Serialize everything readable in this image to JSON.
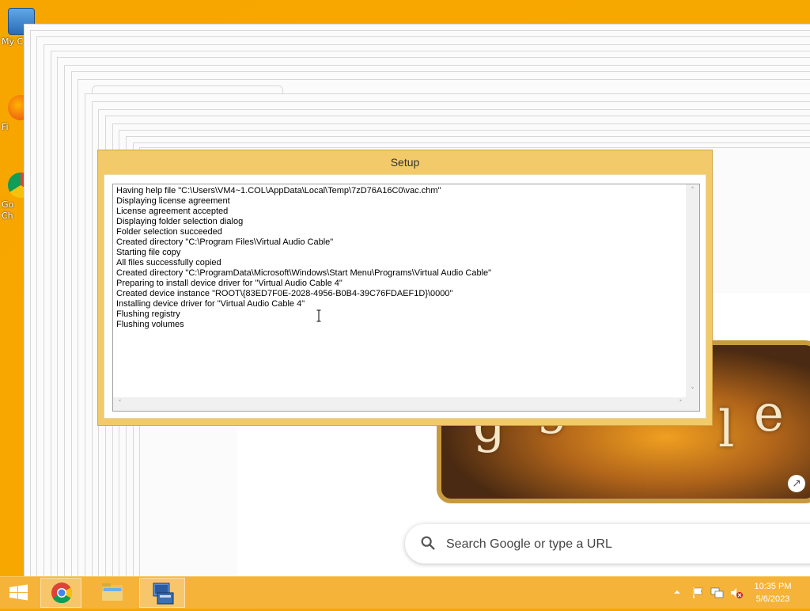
{
  "desktop": {
    "icons": [
      {
        "name": "my-computer-icon",
        "label": "My C"
      },
      {
        "name": "firefox-icon",
        "label": "Fi"
      },
      {
        "name": "chrome-desktop-icon",
        "label": "Go\nCh"
      }
    ]
  },
  "browser": {
    "search_placeholder": "Search Google or type a URL",
    "doodle_letters": [
      "g",
      "g",
      "l",
      "e"
    ]
  },
  "setup_window": {
    "title": "Setup",
    "log": [
      "Having help file \"C:\\Users\\VM4~1.COL\\AppData\\Local\\Temp\\7zD76A16C0\\vac.chm\"",
      "Displaying license agreement",
      "License agreement accepted",
      "Displaying folder selection dialog",
      "Folder selection succeeded",
      "Created directory \"C:\\Program Files\\Virtual Audio Cable\"",
      "Starting file copy",
      "All files successfully copied",
      "Created directory \"C:\\ProgramData\\Microsoft\\Windows\\Start Menu\\Programs\\Virtual Audio Cable\"",
      "Preparing to install device driver for \"Virtual Audio Cable 4\"",
      "Created device instance \"ROOT\\{83ED7F0E-2028-4956-B0B4-39C76FDAEF1D}\\0000\"",
      "Installing device driver for \"Virtual Audio Cable 4\"",
      "Flushing registry",
      "Flushing volumes"
    ]
  },
  "taskbar": {
    "clock_time": "10:35 PM",
    "clock_date": "5/6/2023"
  },
  "colors": {
    "desktop": "#f7a600",
    "setup_frame": "#f2ca6a",
    "taskbar": "#f5b33a"
  }
}
